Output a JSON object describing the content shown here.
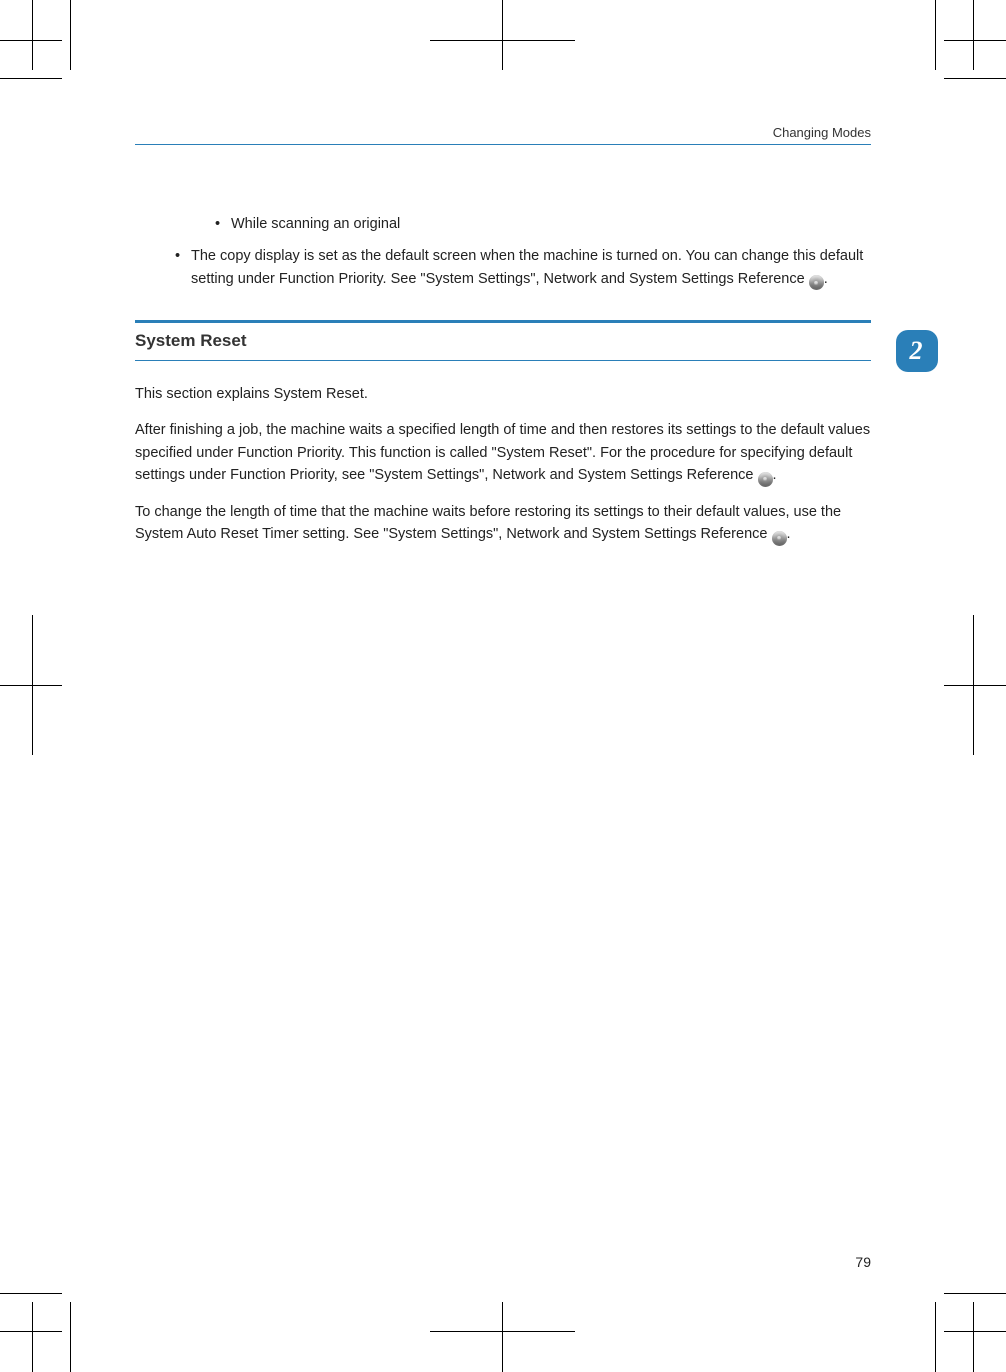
{
  "header": {
    "title": "Changing Modes"
  },
  "chapter": {
    "number": "2"
  },
  "bullets": {
    "sub1": "While scanning an original",
    "main1": "The copy display is set as the default screen when the machine is turned on. You can change this default setting under Function Priority. See \"System Settings\", Network and System Settings Reference ",
    "main1_trail": "."
  },
  "section": {
    "heading": "System Reset",
    "p1": "This section explains System Reset.",
    "p2a": "After finishing a job, the machine waits a specified length of time and then restores its settings to the default values specified under Function Priority. This function is called \"System Reset\". For the procedure for specifying default settings under Function Priority, see \"System Settings\", Network and System Settings Reference ",
    "p2b": ".",
    "p3a": "To change the length of time that the machine waits before restoring its settings to their default values, use the System Auto Reset Timer setting. See \"System Settings\", Network and System Settings Reference ",
    "p3b": "."
  },
  "footer": {
    "page": "79"
  }
}
